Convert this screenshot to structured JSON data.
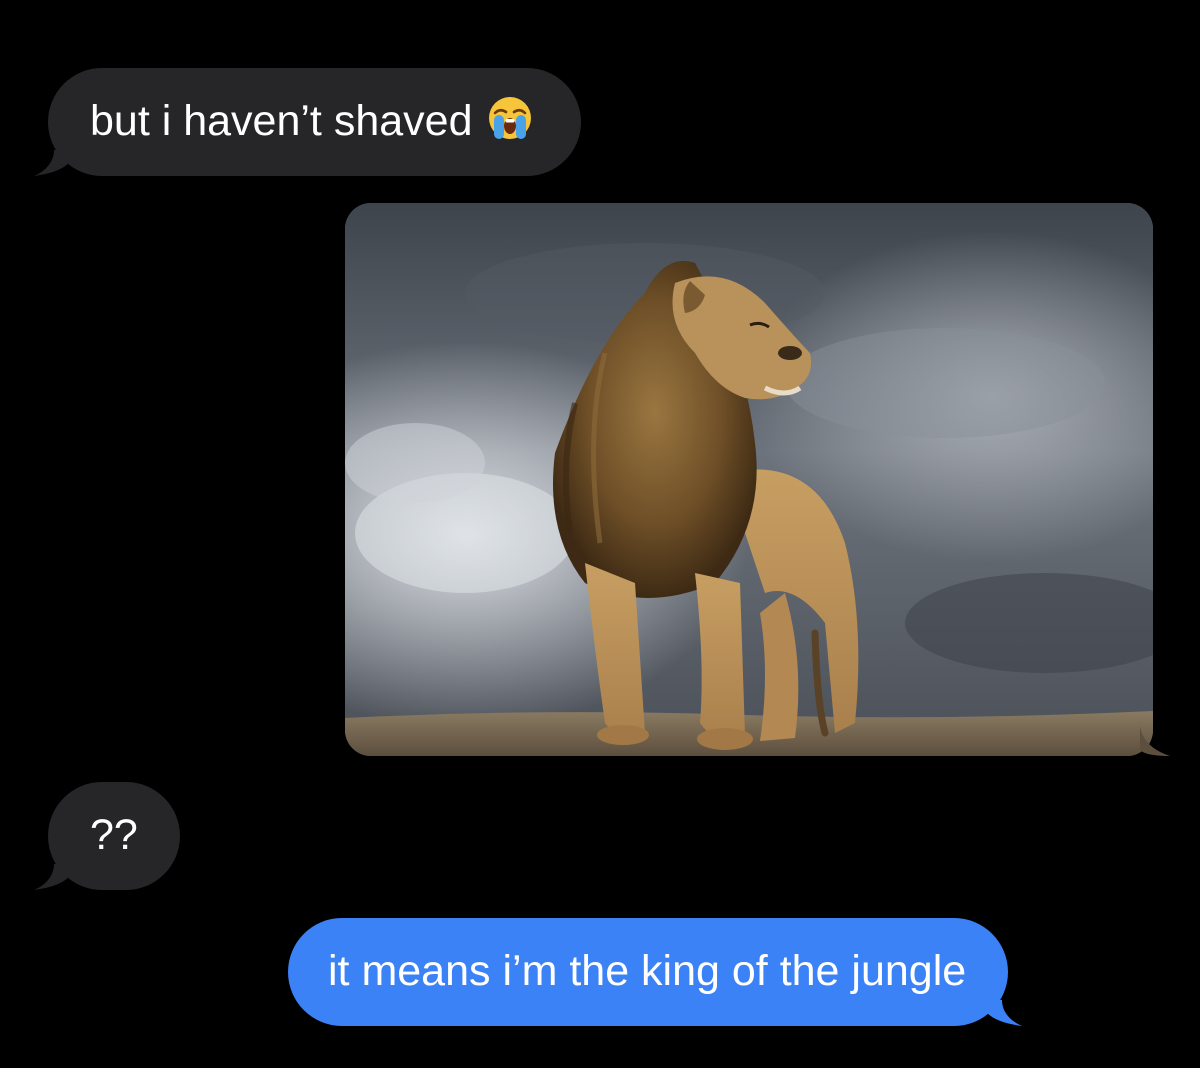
{
  "conversation": {
    "messages": [
      {
        "direction": "incoming",
        "type": "text",
        "text": "but i haven’t shaved",
        "emoji": "loudly-crying-face-emoji"
      },
      {
        "direction": "outgoing",
        "type": "image",
        "image": "lion-photo"
      },
      {
        "direction": "incoming",
        "type": "text",
        "text": "??"
      },
      {
        "direction": "outgoing",
        "type": "text",
        "text": "it means i’m the king of the jungle"
      }
    ]
  },
  "colors": {
    "background": "#000000",
    "incoming_bubble": "#262629",
    "outgoing_bubble": "#3c82f7",
    "text": "#ffffff"
  }
}
